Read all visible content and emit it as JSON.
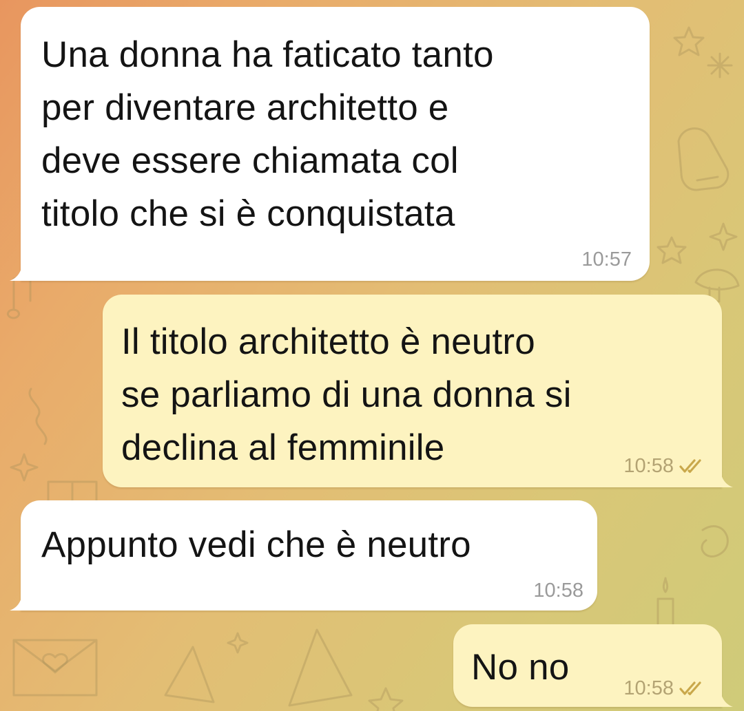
{
  "chat": {
    "messages": [
      {
        "direction": "incoming",
        "text": "Una donna ha faticato tanto\nper diventare architetto e\ndeve essere chiamata col\ntitolo che si è conquistata",
        "time": "10:57"
      },
      {
        "direction": "outgoing",
        "text": "Il titolo architetto è neutro\nse parliamo di una donna si\ndeclina al femminile",
        "time": "10:58",
        "status_icon": "double-check-icon"
      },
      {
        "direction": "incoming",
        "text": "Appunto vedi che è neutro",
        "time": "10:58"
      },
      {
        "direction": "outgoing",
        "text": "No no",
        "time": "10:58",
        "status_icon": "double-check-icon"
      }
    ]
  },
  "colors": {
    "incoming_bubble": "#ffffff",
    "outgoing_bubble": "#fdf3c0",
    "wallpaper_start": "#e8965f",
    "wallpaper_end": "#cfcb79",
    "checkmarks": "#c9a84b"
  }
}
